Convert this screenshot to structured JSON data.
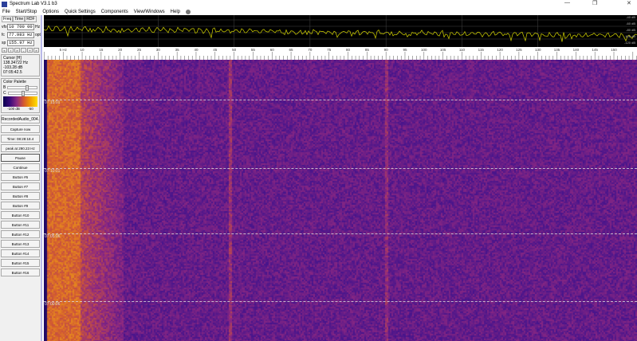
{
  "window": {
    "title": "Spectrum Lab V3.1 b3",
    "minimize": "—",
    "restore": "❐",
    "close": "✕"
  },
  "menu": [
    "File",
    "Start/Stop",
    "Options",
    "Quick Settings",
    "Components",
    "View/Windows",
    "Help"
  ],
  "left": {
    "tabs": [
      "Freq",
      "Time",
      "RDF"
    ],
    "vfo": {
      "label": "vfo",
      "value": "10 700 000",
      "unit": "Hz"
    },
    "fc": {
      "label": "fc",
      "value": "77.983 Hz",
      "unit": "opt"
    },
    "sp": {
      "label": "sp",
      "value": "155.97 Hz"
    },
    "arrows": [
      "«",
      "‹",
      "»",
      "-",
      "+",
      "»"
    ],
    "cursor": {
      "title": "Cursor [H]",
      "freq": "138.34722 Hz",
      "level": "-103.28 dB",
      "time": "07:05:42.5"
    },
    "palette": {
      "title": "Color Palette",
      "b": "B",
      "c": "C",
      "min": "-100 dB",
      "max": "-50"
    },
    "file": "RecordedAudio_004.",
    "capture": "Capture now",
    "time": "Time:  08:28:18.4",
    "peak": "peak at 290.23 Hz",
    "buttons": [
      "Pause",
      "Continue",
      "Button #6",
      "Button #7",
      "Button #8",
      "Button #9",
      "Button #10",
      "Button #11",
      "Button #12",
      "Button #13",
      "Button #14",
      "Button #15",
      "Button #16"
    ]
  },
  "spectrum": {
    "db_labels": [
      "-40 dB",
      "-60 dB",
      "-80 dB",
      "-100 dB",
      "-120 dB"
    ],
    "trace_color": "#d4d400"
  },
  "freq_axis": {
    "labels": [
      "5 Hz",
      "10",
      "15",
      "20",
      "25",
      "30",
      "35",
      "40",
      "45",
      "50",
      "55",
      "60",
      "65",
      "70",
      "75",
      "80",
      "85",
      "90",
      "95",
      "100",
      "105",
      "110",
      "115",
      "120",
      "125",
      "130",
      "135",
      "140",
      "145",
      "150"
    ]
  },
  "waterfall": {
    "timestamps": [
      "07:15:01",
      "07:10:01",
      "07:05:06",
      "07:00:06"
    ]
  }
}
